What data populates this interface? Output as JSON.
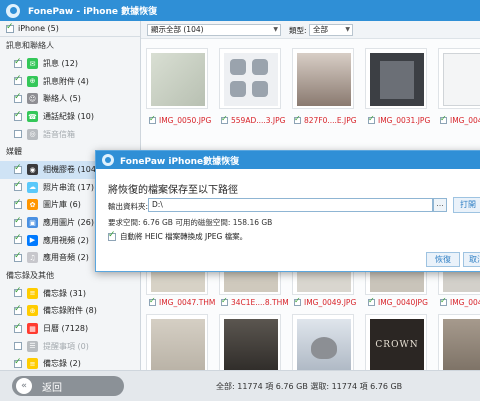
{
  "app": {
    "title": "FonePaw - iPhone 數據恢復"
  },
  "sidebar": {
    "device": {
      "label": "iPhone (5)"
    },
    "categories": [
      {
        "label": "訊息和聯絡人",
        "items": [
          {
            "label": "訊息 (12)",
            "icon": "message-icon",
            "color": "#34c759"
          },
          {
            "label": "訊息附件 (4)",
            "icon": "attachment-icon",
            "color": "#34c759"
          },
          {
            "label": "聯絡人 (5)",
            "icon": "contacts-icon",
            "color": "#8e8e93"
          },
          {
            "label": "通話紀錄 (10)",
            "icon": "phone-icon",
            "color": "#34c759"
          },
          {
            "label": "語音信箱",
            "icon": "voicemail-icon",
            "color": "#b8bcc0"
          }
        ]
      },
      {
        "label": "媒體",
        "items": [
          {
            "label": "相機膠卷 (104)",
            "icon": "camera-icon",
            "color": "#3a3a3c"
          },
          {
            "label": "照片串流 (17)",
            "icon": "photo-stream-icon",
            "color": "#5ac8fa"
          },
          {
            "label": "圖片庫 (6)",
            "icon": "photo-library-icon",
            "color": "#ff9500"
          },
          {
            "label": "應用圖片 (26)",
            "icon": "app-photo-icon",
            "color": "#4a90e2"
          },
          {
            "label": "應用視頻 (2)",
            "icon": "app-video-icon",
            "color": "#007aff"
          },
          {
            "label": "應用音頻 (2)",
            "icon": "app-audio-icon",
            "color": "#c7c7cc"
          }
        ]
      },
      {
        "label": "備忘錄及其他",
        "items": [
          {
            "label": "備忘錄 (31)",
            "icon": "notes-icon",
            "color": "#ffcc00"
          },
          {
            "label": "備忘錄附件 (8)",
            "icon": "notes-attachment-icon",
            "color": "#ffcc00"
          },
          {
            "label": "日曆 (7128)",
            "icon": "calendar-icon",
            "color": "#ff3b30"
          },
          {
            "label": "提醒事項 (0)",
            "icon": "reminders-icon",
            "color": "#b8bcc0"
          },
          {
            "label": "備忘錄 (2)",
            "icon": "notes-icon",
            "color": "#ffcc00"
          }
        ]
      }
    ]
  },
  "filter": {
    "show_value": "顯示全部 (104)",
    "type_label": "類型:",
    "type_value": "全部"
  },
  "photos": {
    "row1": [
      {
        "name": "IMG_0050.JPG",
        "tone": "#cfd6c8"
      },
      {
        "name": "559AD....3.JPG",
        "tone": "#e3e6ea"
      },
      {
        "name": "827F0....E.JPG",
        "tone": "#b9a9a0"
      },
      {
        "name": "IMG_0031.JPG",
        "tone": "#3c3f44"
      },
      {
        "name": "IMG_0049",
        "tone": "#e4e6e8"
      }
    ],
    "row2": [
      {
        "name": "IMG_0047.THM",
        "tone": "#d7d2c6"
      },
      {
        "name": "34C1E....8.THM",
        "tone": "#cfc9bd"
      },
      {
        "name": "IMG_0049.JPG",
        "tone": "#d9d6cf"
      },
      {
        "name": "IMG_0040JPG",
        "tone": "#c9c4ba"
      },
      {
        "name": "IMG_0045",
        "tone": "#d3d0ca"
      }
    ],
    "row3_tones": [
      "#c8c2b7",
      "#4e4a46",
      "#c9d2dc",
      "#2b2623",
      "#9a8f83"
    ],
    "crown_text": "CROWN"
  },
  "dialog": {
    "title": "FonePaw iPhone數據恢復",
    "heading": "將恢復的檔案保存至以下路徑",
    "path_label": "輸出資料夾:",
    "path_value": "D:\\",
    "browse_label": "...",
    "open_label": "打開",
    "space": "要求空間: 6.76 GB   可用的磁盤空間: 158.16 GB",
    "heic_label": "自動將 HEIC 檔案轉換成 JPEG 檔案。",
    "restore_label": "恢復",
    "cancel_label": "取消"
  },
  "bottom": {
    "back_label": "返回",
    "summary": "全部: 11774 項 6.76 GB 選取: 11774 項 6.76 GB"
  }
}
